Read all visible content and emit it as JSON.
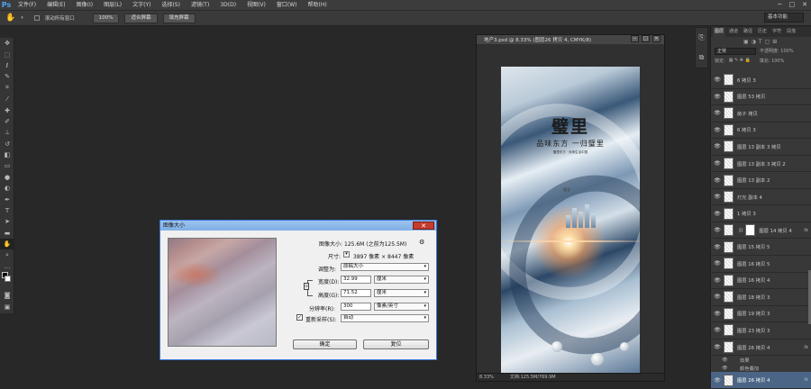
{
  "app": {
    "logo": "Ps",
    "menu": [
      "文件(F)",
      "编辑(E)",
      "图像(I)",
      "图层(L)",
      "文字(Y)",
      "选择(S)",
      "滤镜(T)",
      "3D(D)",
      "视图(V)",
      "窗口(W)",
      "帮助(H)"
    ],
    "window_controls": [
      "─",
      "□",
      "✕"
    ],
    "workspace": "基本功能"
  },
  "options": {
    "scroll_all_label": "滚动所有窗口",
    "zoom_100": "100%",
    "fit_screen": "适合屏幕",
    "fill_screen": "填充屏幕"
  },
  "document": {
    "title": "地产3.psd @ 8.33% (图层26 拷贝 4, CMYK/8)",
    "zoom": "8.33%",
    "doc_size": "文档:125.5M/769.9M",
    "poster_title": "璧里",
    "poster_subtitle": "品味东方 一归璧里",
    "poster_small": "璧里东方 · 传承生活中国",
    "poster_seal": "璧里"
  },
  "panels": {
    "tabs": [
      "图层",
      "通道",
      "路径",
      "历史",
      "字符",
      "段落"
    ],
    "blend_mode": "正常",
    "opacity": "不透明度: 100%",
    "lock": "锁定:",
    "fill": "填充: 100%"
  },
  "layers": [
    {
      "name": "6 拷贝 3",
      "thumb": "plain"
    },
    {
      "name": "图层 53 拷贝",
      "thumb": "plain"
    },
    {
      "name": "房子 拷贝",
      "thumb": "plain"
    },
    {
      "name": "6 拷贝 3",
      "thumb": "plain"
    },
    {
      "name": "图层 13 副本 3 拷贝",
      "thumb": "plain"
    },
    {
      "name": "图层 13 副本 3 拷贝 2",
      "thumb": "plain"
    },
    {
      "name": "图层 13 副本 2",
      "thumb": "plain"
    },
    {
      "name": "灯光 副本 4",
      "thumb": "plain"
    },
    {
      "name": "1 拷贝 3",
      "thumb": "plain"
    },
    {
      "name": "图层 14 拷贝 4",
      "thumb": "mask",
      "fx": "fx"
    },
    {
      "name": "图层 15 拷贝 5",
      "thumb": "plain"
    },
    {
      "name": "图层 16 拷贝 5",
      "thumb": "plain"
    },
    {
      "name": "图层 16 拷贝 4",
      "thumb": "plain"
    },
    {
      "name": "图层 18 拷贝 3",
      "thumb": "plain"
    },
    {
      "name": "图层 19 拷贝 3",
      "thumb": "plain"
    },
    {
      "name": "图层 23 拷贝 3",
      "thumb": "plain"
    },
    {
      "name": "图层 26 拷贝 4",
      "thumb": "plain",
      "fx": "fx"
    }
  ],
  "layer_effects": [
    "效果",
    "颜色叠加"
  ],
  "selected_layer": {
    "name": "图层 26 拷贝 4",
    "fx": "fx"
  },
  "dialog": {
    "title": "图像大小",
    "image_size_label": "图像大小:",
    "image_size_value": "125.6M (之前为125.5M)",
    "dimensions_label": "尺寸:",
    "dimensions_value": "3897 像素 × 8447 像素",
    "fit_label": "调整为:",
    "fit_value": "原稿大小",
    "width_label": "宽度(D):",
    "width_value": "32.99",
    "width_unit": "厘米",
    "height_label": "高度(G):",
    "height_value": "71.52",
    "height_unit": "厘米",
    "resolution_label": "分辨率(R):",
    "resolution_value": "300",
    "resolution_unit": "像素/英寸",
    "resample_label": "重新采样(S):",
    "resample_value": "自动",
    "resample_checked": true,
    "ok": "确定",
    "reset": "复位",
    "close": "✕"
  }
}
